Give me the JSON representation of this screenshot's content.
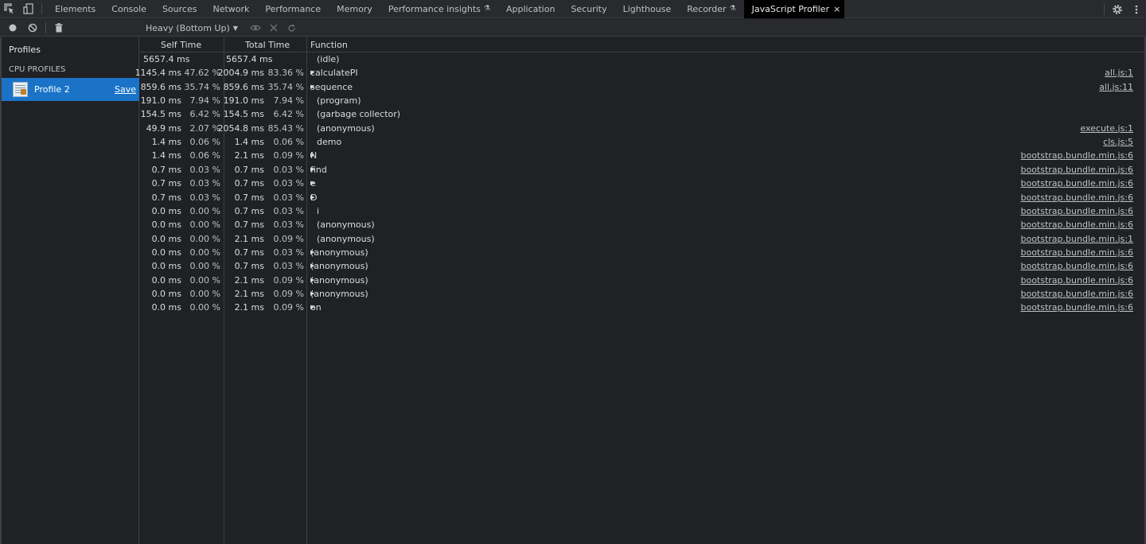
{
  "tabs": [
    {
      "label": "Elements",
      "flask": false,
      "active": false
    },
    {
      "label": "Console",
      "flask": false,
      "active": false
    },
    {
      "label": "Sources",
      "flask": false,
      "active": false
    },
    {
      "label": "Network",
      "flask": false,
      "active": false
    },
    {
      "label": "Performance",
      "flask": false,
      "active": false
    },
    {
      "label": "Memory",
      "flask": false,
      "active": false
    },
    {
      "label": "Performance insights",
      "flask": true,
      "active": false
    },
    {
      "label": "Application",
      "flask": false,
      "active": false
    },
    {
      "label": "Security",
      "flask": false,
      "active": false
    },
    {
      "label": "Lighthouse",
      "flask": false,
      "active": false
    },
    {
      "label": "Recorder",
      "flask": true,
      "active": false
    },
    {
      "label": "JavaScript Profiler",
      "flask": false,
      "active": true,
      "close": "×"
    }
  ],
  "toolbar": {
    "view_mode": "Heavy (Bottom Up)"
  },
  "sidebar": {
    "title": "Profiles",
    "section": "CPU PROFILES",
    "profile": {
      "label": "Profile 2",
      "save": "Save"
    }
  },
  "columns": {
    "self_time": "Self Time",
    "total_time": "Total Time",
    "function": "Function"
  },
  "rows": [
    {
      "self": "5657.4 ms",
      "self_pct": "",
      "total": "5657.4 ms",
      "total_pct": "",
      "fn": "(idle)",
      "expandable": false,
      "url": ""
    },
    {
      "self": "1145.4 ms",
      "self_pct": "47.62 %",
      "total": "2004.9 ms",
      "total_pct": "83.36 %",
      "fn": "calculatePI",
      "expandable": true,
      "url": "all.js:1"
    },
    {
      "self": "859.6 ms",
      "self_pct": "35.74 %",
      "total": "859.6 ms",
      "total_pct": "35.74 %",
      "fn": "sequence",
      "expandable": true,
      "url": "all.js:11"
    },
    {
      "self": "191.0 ms",
      "self_pct": "7.94 %",
      "total": "191.0 ms",
      "total_pct": "7.94 %",
      "fn": "(program)",
      "expandable": false,
      "url": ""
    },
    {
      "self": "154.5 ms",
      "self_pct": "6.42 %",
      "total": "154.5 ms",
      "total_pct": "6.42 %",
      "fn": "(garbage collector)",
      "expandable": false,
      "url": ""
    },
    {
      "self": "49.9 ms",
      "self_pct": "2.07 %",
      "total": "2054.8 ms",
      "total_pct": "85.43 %",
      "fn": "(anonymous)",
      "expandable": false,
      "url": "execute.js:1"
    },
    {
      "self": "1.4 ms",
      "self_pct": "0.06 %",
      "total": "1.4 ms",
      "total_pct": "0.06 %",
      "fn": "demo",
      "expandable": false,
      "url": "cls.js:5"
    },
    {
      "self": "1.4 ms",
      "self_pct": "0.06 %",
      "total": "2.1 ms",
      "total_pct": "0.09 %",
      "fn": "N",
      "expandable": true,
      "url": "bootstrap.bundle.min.js:6"
    },
    {
      "self": "0.7 ms",
      "self_pct": "0.03 %",
      "total": "0.7 ms",
      "total_pct": "0.03 %",
      "fn": "find",
      "expandable": true,
      "url": "bootstrap.bundle.min.js:6"
    },
    {
      "self": "0.7 ms",
      "self_pct": "0.03 %",
      "total": "0.7 ms",
      "total_pct": "0.03 %",
      "fn": "e",
      "expandable": true,
      "url": "bootstrap.bundle.min.js:6"
    },
    {
      "self": "0.7 ms",
      "self_pct": "0.03 %",
      "total": "0.7 ms",
      "total_pct": "0.03 %",
      "fn": "D",
      "expandable": true,
      "url": "bootstrap.bundle.min.js:6"
    },
    {
      "self": "0.0 ms",
      "self_pct": "0.00 %",
      "total": "0.7 ms",
      "total_pct": "0.03 %",
      "fn": "i",
      "expandable": false,
      "url": "bootstrap.bundle.min.js:6"
    },
    {
      "self": "0.0 ms",
      "self_pct": "0.00 %",
      "total": "0.7 ms",
      "total_pct": "0.03 %",
      "fn": "(anonymous)",
      "expandable": false,
      "url": "bootstrap.bundle.min.js:6"
    },
    {
      "self": "0.0 ms",
      "self_pct": "0.00 %",
      "total": "2.1 ms",
      "total_pct": "0.09 %",
      "fn": "(anonymous)",
      "expandable": false,
      "url": "bootstrap.bundle.min.js:1"
    },
    {
      "self": "0.0 ms",
      "self_pct": "0.00 %",
      "total": "0.7 ms",
      "total_pct": "0.03 %",
      "fn": "(anonymous)",
      "expandable": true,
      "url": "bootstrap.bundle.min.js:6"
    },
    {
      "self": "0.0 ms",
      "self_pct": "0.00 %",
      "total": "0.7 ms",
      "total_pct": "0.03 %",
      "fn": "(anonymous)",
      "expandable": true,
      "url": "bootstrap.bundle.min.js:6"
    },
    {
      "self": "0.0 ms",
      "self_pct": "0.00 %",
      "total": "2.1 ms",
      "total_pct": "0.09 %",
      "fn": "(anonymous)",
      "expandable": true,
      "url": "bootstrap.bundle.min.js:6"
    },
    {
      "self": "0.0 ms",
      "self_pct": "0.00 %",
      "total": "2.1 ms",
      "total_pct": "0.09 %",
      "fn": "(anonymous)",
      "expandable": true,
      "url": "bootstrap.bundle.min.js:6"
    },
    {
      "self": "0.0 ms",
      "self_pct": "0.00 %",
      "total": "2.1 ms",
      "total_pct": "0.09 %",
      "fn": "on",
      "expandable": true,
      "url": "bootstrap.bundle.min.js:6"
    }
  ]
}
